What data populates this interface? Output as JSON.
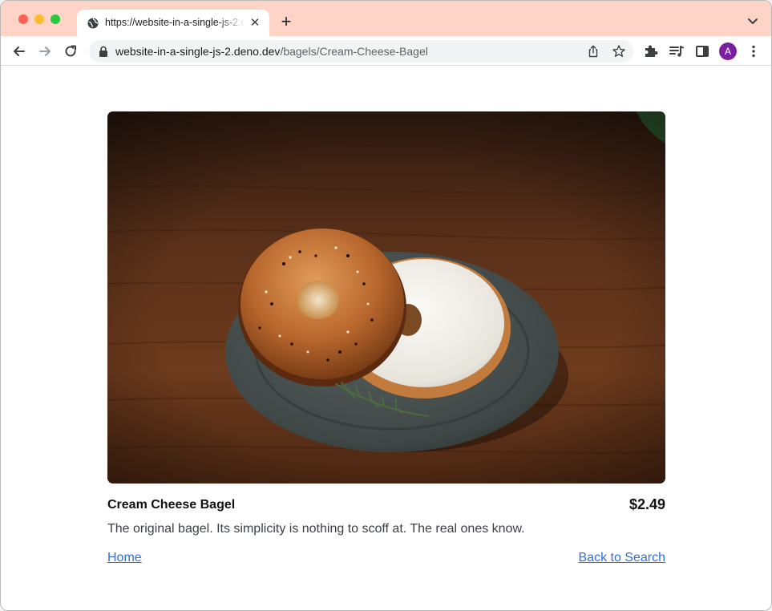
{
  "browser": {
    "tab_title": "https://website-in-a-single-js-2.deno.dev/bagels/Cream-Cheese-Bagel",
    "url_host": "website-in-a-single-js-2.deno.dev",
    "url_path": "/bagels/Cream-Cheese-Bagel",
    "profile_initial": "A",
    "colors": {
      "tabstrip": "#fdd4c6",
      "profile": "#7b1fa2"
    },
    "icons": [
      "globe-icon",
      "close-icon",
      "plus-icon",
      "chevron-down-icon",
      "back-arrow-icon",
      "forward-arrow-icon",
      "reload-icon",
      "lock-icon",
      "share-icon",
      "star-icon",
      "puzzle-icon",
      "media-icon",
      "side-panel-icon",
      "more-vert-icon"
    ]
  },
  "product": {
    "name": "Cream Cheese Bagel",
    "price": "$2.49",
    "description": "The original bagel. Its simplicity is nothing to scoff at. The real ones know.",
    "image_subject": "bagel-photo"
  },
  "links": {
    "home": "Home",
    "back": "Back to Search",
    "color": "#2f6fd6"
  }
}
